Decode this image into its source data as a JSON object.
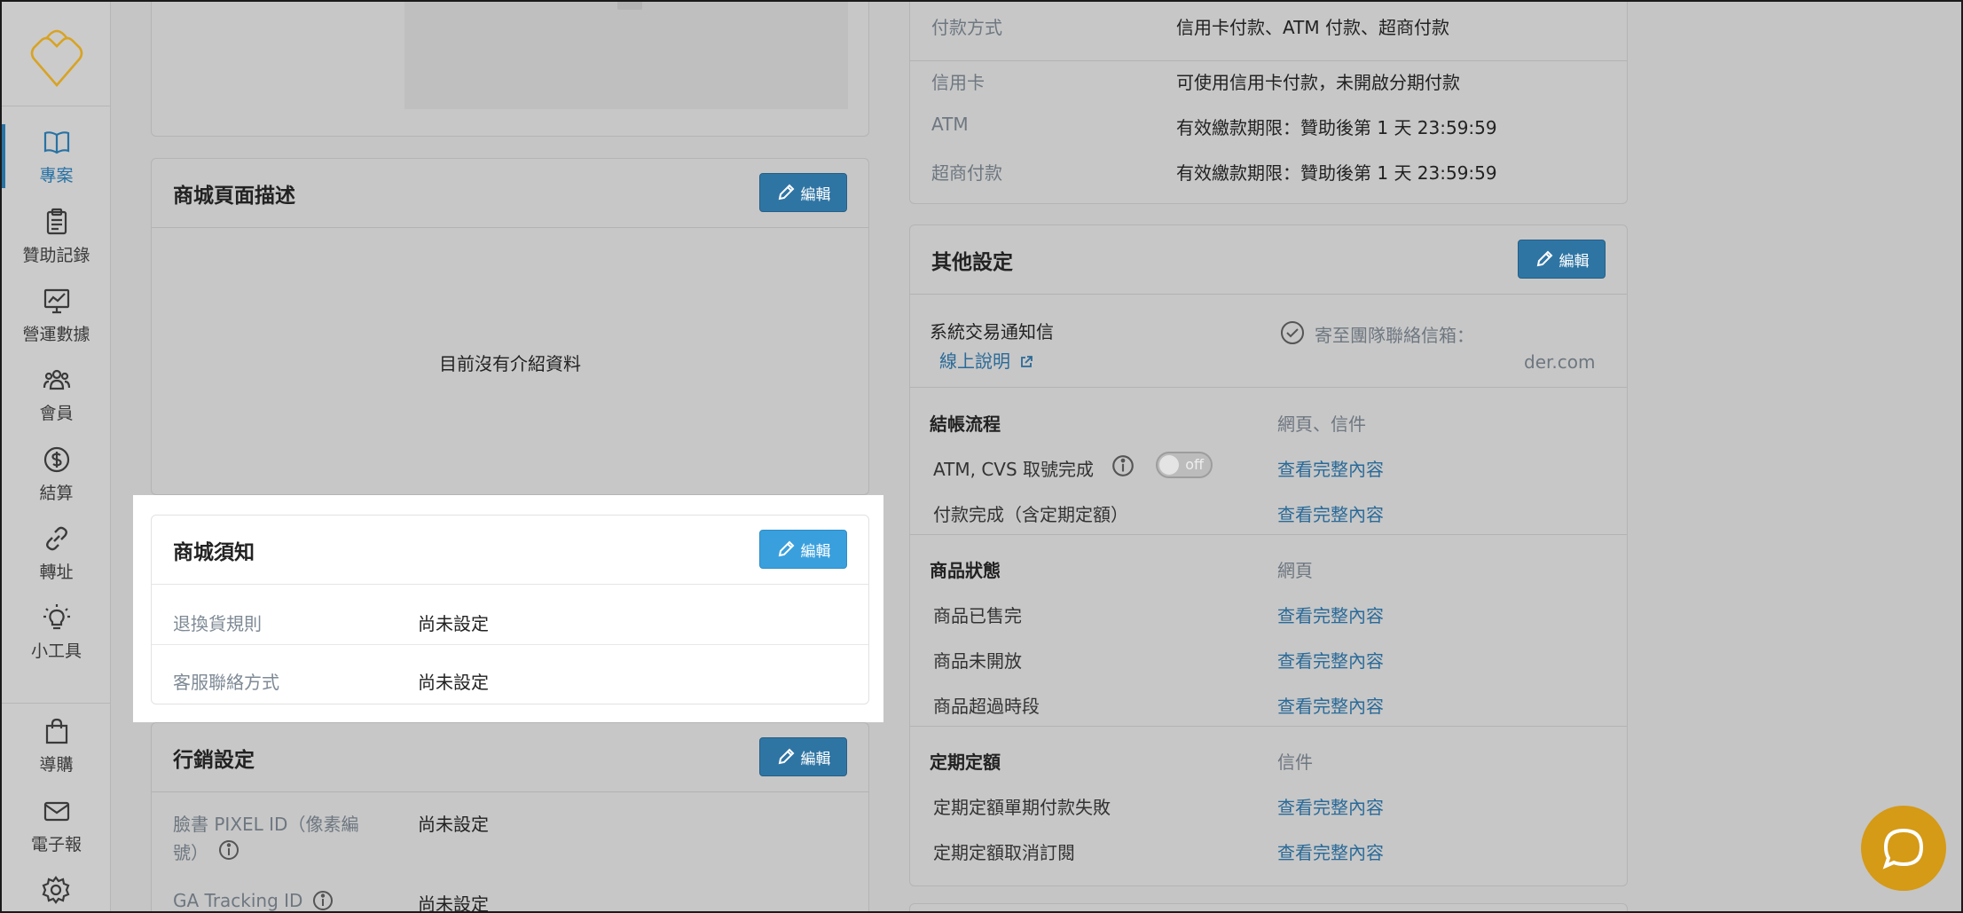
{
  "sidebar": {
    "items": [
      {
        "label": "專案",
        "icon": "book-icon",
        "active": true
      },
      {
        "label": "贊助記錄",
        "icon": "clipboard-icon"
      },
      {
        "label": "營運數據",
        "icon": "chart-board-icon"
      },
      {
        "label": "會員",
        "icon": "users-icon"
      },
      {
        "label": "結算",
        "icon": "dollar-icon"
      },
      {
        "label": "轉址",
        "icon": "link-icon"
      },
      {
        "label": "小工具",
        "icon": "lightbulb-icon"
      },
      {
        "label": "導購",
        "icon": "shopping-bag-icon"
      },
      {
        "label": "電子報",
        "icon": "mail-icon"
      }
    ]
  },
  "left": {
    "shop_description": {
      "title": "商城頁面描述",
      "edit_label": "編輯",
      "empty_text": "目前沒有介紹資料"
    },
    "shop_notice": {
      "title": "商城須知",
      "edit_label": "編輯",
      "rows": [
        {
          "label": "退換貨規則",
          "value": "尚未設定"
        },
        {
          "label": "客服聯絡方式",
          "value": "尚未設定"
        }
      ]
    },
    "marketing": {
      "title": "行銷設定",
      "edit_label": "編輯",
      "rows": [
        {
          "label_line1": "臉書 PIXEL ID（像素編",
          "label_line2": "號）",
          "value": "尚未設定"
        },
        {
          "label": "GA Tracking ID",
          "value": "尚未設定"
        }
      ]
    }
  },
  "right": {
    "payment": {
      "rows": [
        {
          "label": "付款方式",
          "value": "信用卡付款、ATM 付款、超商付款"
        },
        {
          "label": "信用卡",
          "value": "可使用信用卡付款，未開啟分期付款"
        },
        {
          "label": "ATM",
          "value": "有效繳款期限：贊助後第 1 天 23:59:59"
        },
        {
          "label": "超商付款",
          "value": "有效繳款期限：贊助後第 1 天 23:59:59"
        }
      ]
    },
    "other": {
      "title": "其他設定",
      "edit_label": "編輯",
      "notify": {
        "label": "系統交易通知信",
        "help_link": "線上說明",
        "send_to": "寄至團隊聯絡信箱：",
        "email_partial": "der.com"
      },
      "checkout": {
        "title": "結帳流程",
        "channel": "網頁、信件",
        "rows": [
          {
            "label": "ATM, CVS 取號完成",
            "toggle": "off",
            "link": "查看完整內容"
          },
          {
            "label": "付款完成（含定期定額）",
            "link": "查看完整內容"
          }
        ]
      },
      "product_status": {
        "title": "商品狀態",
        "channel": "網頁",
        "rows": [
          {
            "label": "商品已售完",
            "link": "查看完整內容"
          },
          {
            "label": "商品未開放",
            "link": "查看完整內容"
          },
          {
            "label": "商品超過時段",
            "link": "查看完整內容"
          }
        ]
      },
      "subscription": {
        "title": "定期定額",
        "channel": "信件",
        "rows": [
          {
            "label": "定期定額單期付款失敗",
            "link": "查看完整內容"
          },
          {
            "label": "定期定額取消訂閱",
            "link": "查看完整內容"
          }
        ]
      }
    }
  },
  "colors": {
    "accent": "#2f75a4",
    "highlight_button": "#3aa0dd",
    "chat": "#d59a16",
    "logo": "#d8a323"
  }
}
